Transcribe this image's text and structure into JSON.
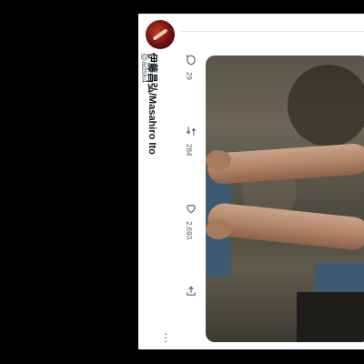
{
  "post": {
    "author": {
      "name": "伊藤昌弘/Masahiro Ito",
      "handle": "@adsk4"
    },
    "actions": {
      "replies": "29",
      "reposts": "284",
      "likes": "2,693"
    },
    "icons": [
      "reply-icon",
      "repost-icon",
      "like-icon",
      "share-icon",
      "more-icon"
    ]
  }
}
